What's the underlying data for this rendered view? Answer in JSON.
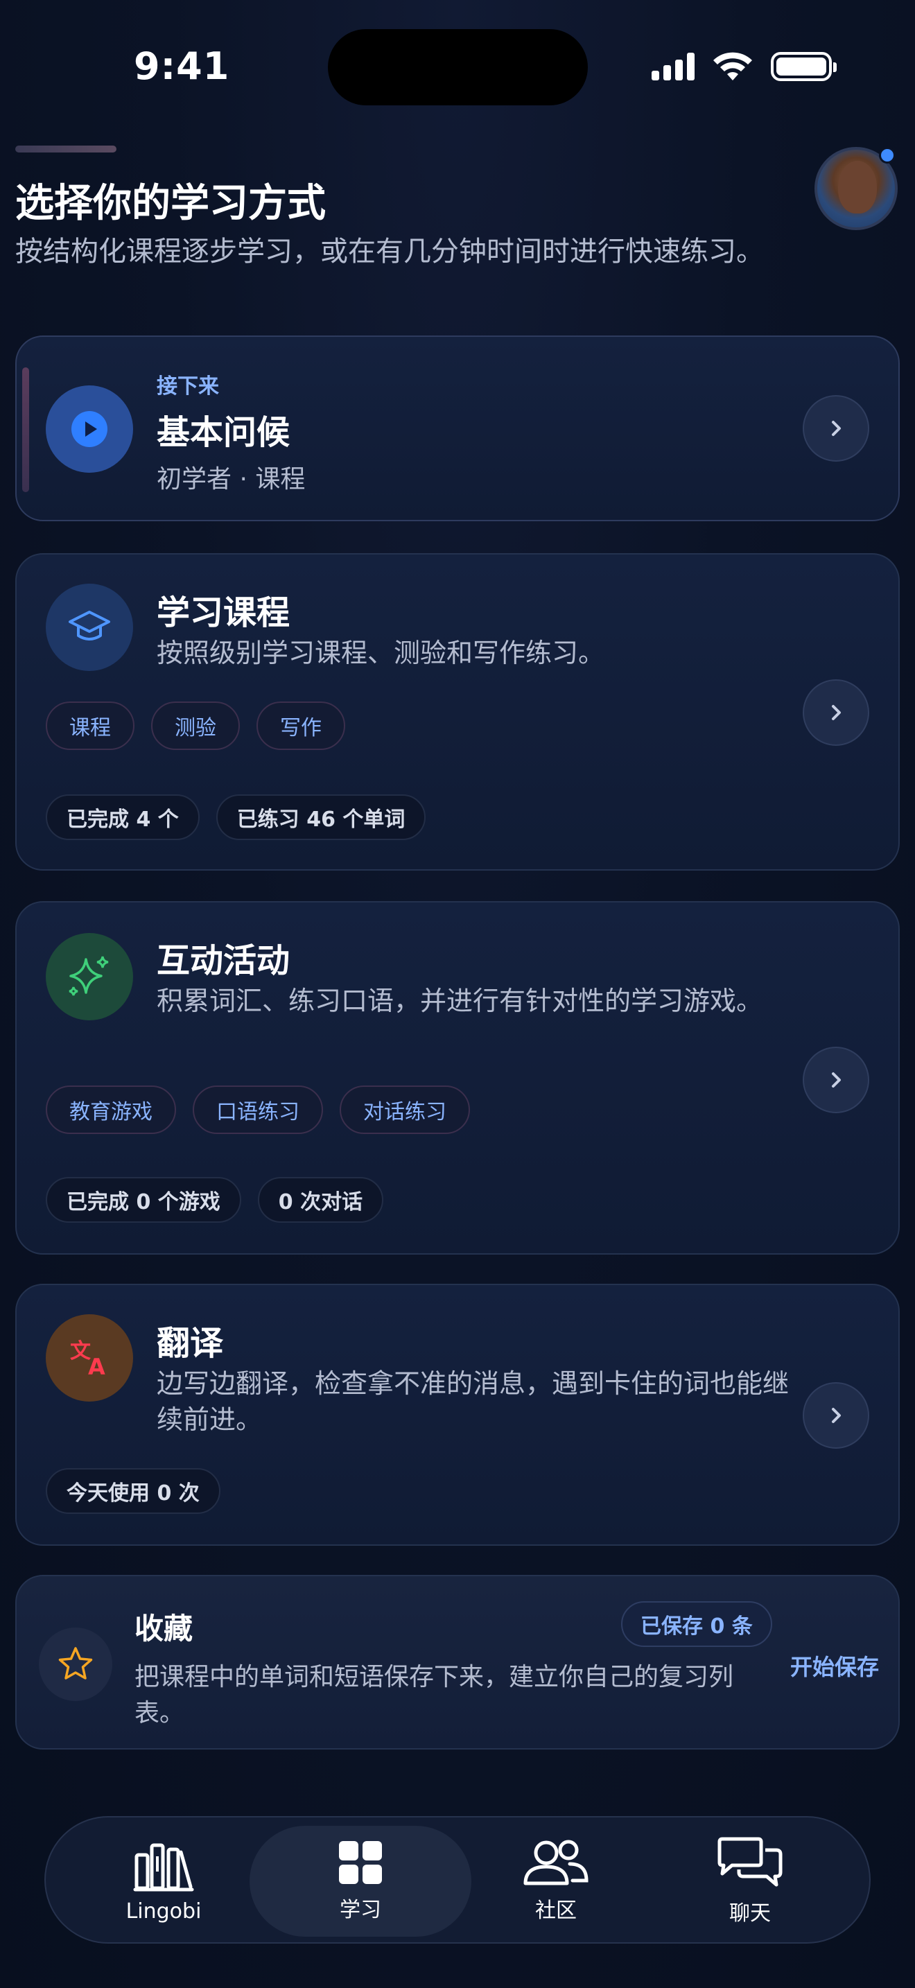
{
  "status_bar": {
    "time": "9:41"
  },
  "header": {
    "title": "选择你的学习方式",
    "subtitle": "按结构化课程逐步学习，或在有几分钟时间时进行快速练习。"
  },
  "up_next": {
    "eyebrow": "接下来",
    "title": "基本问候",
    "meta": "初学者 · 课程"
  },
  "courses": {
    "title": "学习课程",
    "description": "按照级别学习课程、测验和写作练习。",
    "tags": [
      "课程",
      "测验",
      "写作"
    ],
    "stats": [
      "已完成 4 个",
      "已练习 46 个单词"
    ]
  },
  "activities": {
    "title": "互动活动",
    "description": "积累词汇、练习口语，并进行有针对性的学习游戏。",
    "tags": [
      "教育游戏",
      "口语练习",
      "对话练习"
    ],
    "stats": [
      "已完成 0 个游戏",
      "0 次对话"
    ]
  },
  "translate": {
    "title": "翻译",
    "description": "边写边翻译，检查拿不准的消息，遇到卡住的词也能继续前进。",
    "stats": [
      "今天使用 0 次"
    ]
  },
  "favorites": {
    "title": "收藏",
    "badge": "已保存 0 条",
    "description": "把课程中的单词和短语保存下来，建立你自己的复习列表。",
    "action": "开始保存"
  },
  "nav": {
    "items": [
      {
        "label": "Lingobi",
        "icon": "library-icon"
      },
      {
        "label": "学习",
        "icon": "grid-icon"
      },
      {
        "label": "社区",
        "icon": "people-icon"
      },
      {
        "label": "聊天",
        "icon": "chat-icon"
      }
    ],
    "active": "学习"
  },
  "colors": {
    "accent": "#3e8bff",
    "tag_text": "#8ab4ff",
    "background": "#0a1224",
    "card": "#14213e"
  }
}
